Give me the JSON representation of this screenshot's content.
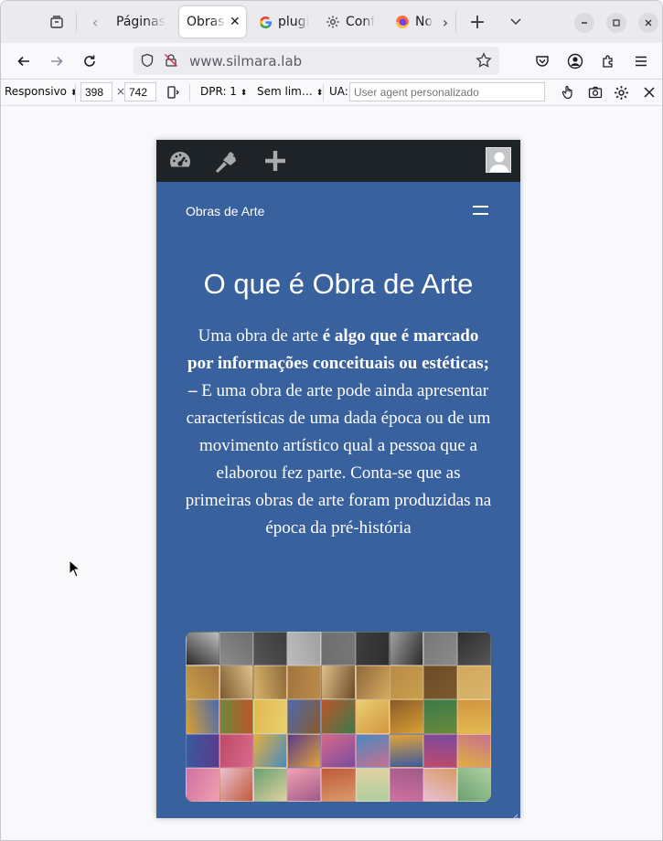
{
  "tabs": [
    {
      "label": "Páginas",
      "active": false
    },
    {
      "label": "Obras",
      "active": true
    },
    {
      "label": "plugi",
      "active": false
    },
    {
      "label": "Conf",
      "active": false
    },
    {
      "label": "No",
      "active": false
    }
  ],
  "url": "www.silmara.lab",
  "rdm": {
    "device": "Responsivo",
    "width": "398",
    "times": "×",
    "height": "742",
    "dpr": "DPR: 1",
    "throttle": "Sem lim…",
    "ua_label": "UA:",
    "ua_placeholder": "User agent personalizado"
  },
  "page": {
    "site_name": "Obras de Arte",
    "title": "O que é Obra de Arte",
    "text_part1": "Uma obra de arte ",
    "text_bold": "é algo que é marcado por informações conceituais ou estéticas; –",
    "text_part2": " E uma obra de arte pode ainda apresentar características de uma dada época ou de um movimento artístico qual a pessoa que a elaborou fez parte. Conta-se que as primeiras obras de arte foram produzidas na época da pré-história"
  },
  "colors": {
    "site_background": "#38619e",
    "admin_bar": "#1d2327"
  },
  "icons": [
    "tab-overview-icon",
    "back-icon",
    "forward-icon",
    "reload-icon",
    "shield-icon",
    "insecure-icon",
    "bookmark-star-icon",
    "pocket-icon",
    "account-icon",
    "extensions-icon",
    "menu-icon",
    "dashboard-icon",
    "customize-icon",
    "plus-icon",
    "hamburger-icon"
  ]
}
